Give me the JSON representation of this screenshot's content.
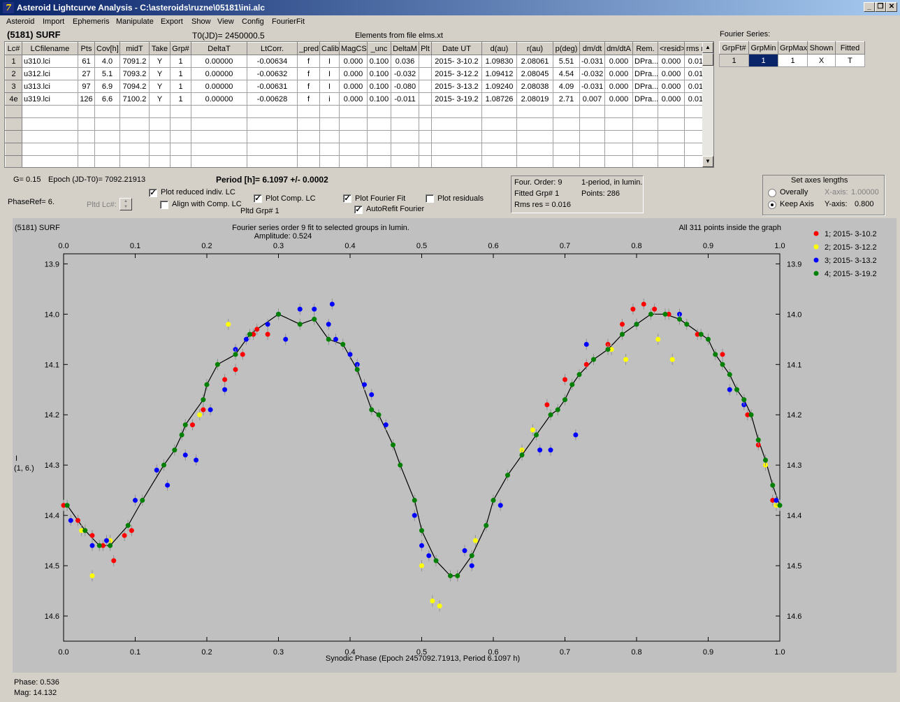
{
  "window": {
    "title": "Asteroid Lightcurve Analysis - C:\\asteroids\\ruzne\\05181\\ini.alc",
    "app_icon_glyph": "7"
  },
  "menu": [
    "Asteroid",
    "Import",
    "Ephemeris",
    "Manipulate",
    "Export",
    "Show",
    "View",
    "Config",
    "FourierFit"
  ],
  "header": {
    "asteroid": "(5181) SURF",
    "t0": "T0(JD)= 2450000.5",
    "elements": "Elements from file elms.xt"
  },
  "lc_table": {
    "columns": [
      "Lc#",
      "LCfilename",
      "Pts",
      "Cov[h]",
      "midT",
      "Take",
      "Grp#",
      "DeltaT",
      "LtCorr.",
      "_pred.",
      "Calib.",
      "MagCS",
      "_unc",
      "DeltaM",
      "Plt",
      "Date UT",
      "d(au)",
      "r(au)",
      "p(deg)",
      "dm/dt",
      "dm/dtA",
      "Rem.",
      "<resid>",
      "rms res"
    ],
    "rows": [
      [
        "1",
        "u310.lci",
        "61",
        "4.0",
        "7091.2",
        "Y",
        "1",
        "0.00000",
        "-0.00634",
        "f",
        "I",
        "0.000",
        "0.100",
        "0.036",
        "",
        "2015- 3-10.2",
        "1.09830",
        "2.08061",
        "5.51",
        "-0.031",
        "0.000",
        "DPra...",
        "0.000",
        "0.016"
      ],
      [
        "2",
        "u312.lci",
        "27",
        "5.1",
        "7093.2",
        "Y",
        "1",
        "0.00000",
        "-0.00632",
        "f",
        "I",
        "0.000",
        "0.100",
        "-0.032",
        "",
        "2015- 3-12.2",
        "1.09412",
        "2.08045",
        "4.54",
        "-0.032",
        "0.000",
        "DPra...",
        "0.000",
        "0.019"
      ],
      [
        "3",
        "u313.lci",
        "97",
        "6.9",
        "7094.2",
        "Y",
        "1",
        "0.00000",
        "-0.00631",
        "f",
        "I",
        "0.000",
        "0.100",
        "-0.080",
        "",
        "2015- 3-13.2",
        "1.09240",
        "2.08038",
        "4.09",
        "-0.031",
        "0.000",
        "DPra...",
        "0.000",
        "0.016"
      ],
      [
        "4e",
        "u319.lci",
        "126",
        "6.6",
        "7100.2",
        "Y",
        "1",
        "0.00000",
        "-0.00628",
        "f",
        "i",
        "0.000",
        "0.100",
        "-0.011",
        "",
        "2015- 3-19.2",
        "1.08726",
        "2.08019",
        "2.71",
        "0.007",
        "0.000",
        "DPra...",
        "0.000",
        "0.015"
      ]
    ],
    "empty_rows": 5
  },
  "fourier_series": {
    "title": "Fourier Series:",
    "columns": [
      "GrpFt#",
      "GrpMin",
      "GrpMax",
      "Shown",
      "Fitted"
    ],
    "row": [
      "1",
      "1",
      "1",
      "X",
      "T"
    ]
  },
  "controls": {
    "g": "G= 0.15",
    "epoch": "Epoch (JD-T0)= 7092.21913",
    "period": "Period [h]= 6.1097 +/- 0.0002",
    "phaseref": "PhaseRef= 6.",
    "pltd_lc": "Pltd Lc#:",
    "plot_reduced": "Plot reduced indiv. LC",
    "align_comp": "Align with Comp. LC",
    "plot_comp": "Plot Comp. LC",
    "pltd_grp": "Pltd Grp#  1",
    "plot_fourier": "Plot Fourier Fit",
    "autorefit": "AutoRefit Fourier",
    "plot_residuals": "Plot residuals"
  },
  "fit_info": {
    "order": "Four. Order:  9",
    "mode": "1-period, in lumin.",
    "fitted_grp": "Fitted Grp# 1",
    "points": "Points: 286",
    "rms": "Rms res     = 0.016"
  },
  "axes_box": {
    "title": "Set axes lengths",
    "overally": "Overally",
    "keep_axis": "Keep Axis",
    "x_label": "X-axis:",
    "x_value": "1.00000",
    "y_label": "Y-axis:",
    "y_value": "0.800",
    "selected": "keep_axis"
  },
  "plot": {
    "name": "(5181) SURF",
    "subtitle": "Fourier series order 9 fit to selected groups in lumin.",
    "amplitude": "Amplitude: 0.524",
    "points_note": "All 311 points inside the graph",
    "ylabel_line1": "I",
    "ylabel_line2": "(1, 6.)",
    "xlabel": "Synodic Phase (Epoch 2457092.71913, Period 6.1097 h)",
    "bg_color": "#c0c0c0",
    "fit_color": "#000000"
  },
  "chart_data": {
    "type": "scatter",
    "x_ticks": [
      "0.0",
      "0.1",
      "0.2",
      "0.3",
      "0.4",
      "0.5",
      "0.6",
      "0.7",
      "0.8",
      "0.9",
      "1.0"
    ],
    "y_ticks": [
      "13.9",
      "14.0",
      "14.1",
      "14.2",
      "14.3",
      "14.4",
      "14.5",
      "14.6"
    ],
    "xlim": [
      0,
      1.0
    ],
    "ylim": [
      14.65,
      13.88
    ],
    "y_inverted": true,
    "grid": false,
    "legend_position": "right",
    "series": [
      {
        "name": "1; 2015- 3-10.2",
        "color": "#ff0000",
        "points": [
          [
            0.0,
            14.38
          ],
          [
            0.02,
            14.41
          ],
          [
            0.04,
            14.44
          ],
          [
            0.055,
            14.46
          ],
          [
            0.07,
            14.49
          ],
          [
            0.085,
            14.44
          ],
          [
            0.095,
            14.43
          ],
          [
            0.18,
            14.22
          ],
          [
            0.195,
            14.19
          ],
          [
            0.225,
            14.13
          ],
          [
            0.24,
            14.11
          ],
          [
            0.25,
            14.08
          ],
          [
            0.265,
            14.04
          ],
          [
            0.27,
            14.03
          ],
          [
            0.285,
            14.04
          ],
          [
            0.675,
            14.18
          ],
          [
            0.7,
            14.13
          ],
          [
            0.73,
            14.1
          ],
          [
            0.76,
            14.06
          ],
          [
            0.78,
            14.02
          ],
          [
            0.795,
            13.99
          ],
          [
            0.81,
            13.98
          ],
          [
            0.825,
            13.99
          ],
          [
            0.845,
            14.0
          ],
          [
            0.885,
            14.04
          ],
          [
            0.92,
            14.08
          ],
          [
            0.955,
            14.2
          ],
          [
            0.97,
            14.26
          ],
          [
            0.98,
            14.3
          ],
          [
            0.99,
            14.37
          ]
        ]
      },
      {
        "name": "2; 2015- 3-12.2",
        "color": "#ffff00",
        "points": [
          [
            0.025,
            14.43
          ],
          [
            0.04,
            14.52
          ],
          [
            0.065,
            14.45
          ],
          [
            0.19,
            14.2
          ],
          [
            0.215,
            14.1
          ],
          [
            0.23,
            14.02
          ],
          [
            0.5,
            14.5
          ],
          [
            0.515,
            14.57
          ],
          [
            0.525,
            14.58
          ],
          [
            0.55,
            14.52
          ],
          [
            0.575,
            14.45
          ],
          [
            0.64,
            14.27
          ],
          [
            0.655,
            14.23
          ],
          [
            0.765,
            14.07
          ],
          [
            0.785,
            14.09
          ],
          [
            0.83,
            14.05
          ],
          [
            0.85,
            14.09
          ],
          [
            0.98,
            14.3
          ],
          [
            0.995,
            14.38
          ]
        ]
      },
      {
        "name": "3; 2015- 3-13.2",
        "color": "#0000ff",
        "points": [
          [
            0.01,
            14.41
          ],
          [
            0.04,
            14.46
          ],
          [
            0.06,
            14.45
          ],
          [
            0.1,
            14.37
          ],
          [
            0.13,
            14.31
          ],
          [
            0.145,
            14.34
          ],
          [
            0.17,
            14.28
          ],
          [
            0.185,
            14.29
          ],
          [
            0.205,
            14.19
          ],
          [
            0.225,
            14.15
          ],
          [
            0.24,
            14.07
          ],
          [
            0.255,
            14.05
          ],
          [
            0.285,
            14.02
          ],
          [
            0.3,
            14.0
          ],
          [
            0.31,
            14.05
          ],
          [
            0.33,
            13.99
          ],
          [
            0.35,
            13.99
          ],
          [
            0.37,
            14.02
          ],
          [
            0.375,
            13.98
          ],
          [
            0.38,
            14.05
          ],
          [
            0.4,
            14.08
          ],
          [
            0.41,
            14.1
          ],
          [
            0.42,
            14.14
          ],
          [
            0.43,
            14.16
          ],
          [
            0.45,
            14.22
          ],
          [
            0.49,
            14.4
          ],
          [
            0.5,
            14.46
          ],
          [
            0.51,
            14.48
          ],
          [
            0.56,
            14.47
          ],
          [
            0.57,
            14.5
          ],
          [
            0.61,
            14.38
          ],
          [
            0.665,
            14.27
          ],
          [
            0.68,
            14.27
          ],
          [
            0.715,
            14.24
          ],
          [
            0.73,
            14.06
          ],
          [
            0.8,
            14.02
          ],
          [
            0.86,
            14.0
          ],
          [
            0.93,
            14.15
          ],
          [
            0.95,
            14.18
          ],
          [
            0.995,
            14.37
          ]
        ]
      },
      {
        "name": "4; 2015- 3-19.2",
        "color": "#008000",
        "points": [
          [
            0.005,
            14.38
          ],
          [
            0.03,
            14.43
          ],
          [
            0.05,
            14.46
          ],
          [
            0.065,
            14.46
          ],
          [
            0.09,
            14.42
          ],
          [
            0.11,
            14.37
          ],
          [
            0.14,
            14.3
          ],
          [
            0.155,
            14.27
          ],
          [
            0.165,
            14.24
          ],
          [
            0.17,
            14.22
          ],
          [
            0.195,
            14.17
          ],
          [
            0.2,
            14.14
          ],
          [
            0.215,
            14.1
          ],
          [
            0.24,
            14.08
          ],
          [
            0.26,
            14.04
          ],
          [
            0.3,
            14.0
          ],
          [
            0.33,
            14.02
          ],
          [
            0.35,
            14.01
          ],
          [
            0.37,
            14.05
          ],
          [
            0.39,
            14.06
          ],
          [
            0.41,
            14.11
          ],
          [
            0.43,
            14.19
          ],
          [
            0.44,
            14.2
          ],
          [
            0.46,
            14.26
          ],
          [
            0.47,
            14.3
          ],
          [
            0.49,
            14.37
          ],
          [
            0.5,
            14.43
          ],
          [
            0.52,
            14.49
          ],
          [
            0.54,
            14.52
          ],
          [
            0.55,
            14.52
          ],
          [
            0.57,
            14.48
          ],
          [
            0.59,
            14.42
          ],
          [
            0.6,
            14.37
          ],
          [
            0.62,
            14.32
          ],
          [
            0.64,
            14.28
          ],
          [
            0.66,
            14.24
          ],
          [
            0.68,
            14.2
          ],
          [
            0.69,
            14.19
          ],
          [
            0.7,
            14.17
          ],
          [
            0.71,
            14.14
          ],
          [
            0.72,
            14.12
          ],
          [
            0.74,
            14.09
          ],
          [
            0.76,
            14.07
          ],
          [
            0.78,
            14.04
          ],
          [
            0.8,
            14.02
          ],
          [
            0.82,
            14.0
          ],
          [
            0.84,
            14.0
          ],
          [
            0.86,
            14.01
          ],
          [
            0.87,
            14.02
          ],
          [
            0.89,
            14.04
          ],
          [
            0.9,
            14.05
          ],
          [
            0.91,
            14.08
          ],
          [
            0.92,
            14.1
          ],
          [
            0.93,
            14.12
          ],
          [
            0.94,
            14.15
          ],
          [
            0.95,
            14.17
          ],
          [
            0.96,
            14.2
          ],
          [
            0.97,
            14.25
          ],
          [
            0.98,
            14.29
          ],
          [
            0.99,
            14.34
          ],
          [
            1.0,
            14.38
          ]
        ]
      }
    ]
  },
  "status": {
    "phase": "Phase:  0.536",
    "mag": "Mag:    14.132"
  }
}
